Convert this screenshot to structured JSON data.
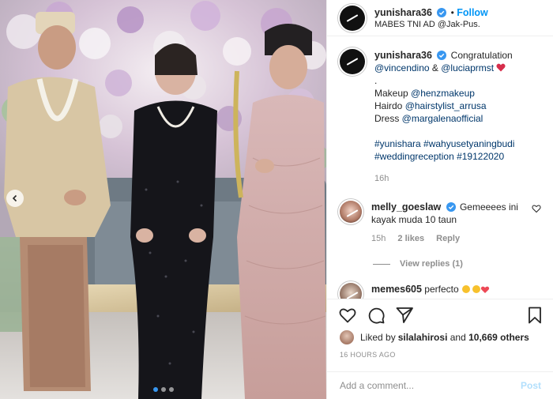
{
  "post": {
    "username": "yunishara36",
    "follow_label": "Follow",
    "location": "MABES TNI AD @Jak-Pus."
  },
  "caption": {
    "username": "yunishara36",
    "text": "Congratulation",
    "mention_1": "@vincendino",
    "and": " & ",
    "mention_2": "@luciaprmst",
    "dot": ".",
    "makeup_label": "Makeup ",
    "makeup_user": "@henzmakeup",
    "hairdo_label": "Hairdo ",
    "hairdo_user": "@hairstylist_arrusa",
    "dress_label": "Dress ",
    "dress_user": "@margalenaofficial",
    "hashtags_line1": "#yunishara #wahyusetyaningbudi",
    "hashtags_line2": "#weddingreception #19122020",
    "time": "16h"
  },
  "comments": [
    {
      "username": "melly_goeslaw",
      "text_1": "Gemeeees ini",
      "text_2": "kayak muda 10 taun",
      "time": "15h",
      "likes": "2 likes",
      "reply": "Reply",
      "view_replies": "View replies (1)"
    },
    {
      "username": "memes605",
      "text": "perfecto"
    }
  ],
  "footer": {
    "liked_prefix": "Liked by ",
    "liked_user": "silalahirosi",
    "liked_and": " and ",
    "liked_count": "10,669 others",
    "timestamp": "16 HOURS AGO",
    "add_comment_placeholder": "Add a comment...",
    "post_label": "Post"
  },
  "carousel": {
    "current": 1,
    "total": 3
  },
  "colors": {
    "link": "#00376b",
    "follow": "#0095f6",
    "verified": "#3897f0",
    "heart": "#ed4956"
  }
}
